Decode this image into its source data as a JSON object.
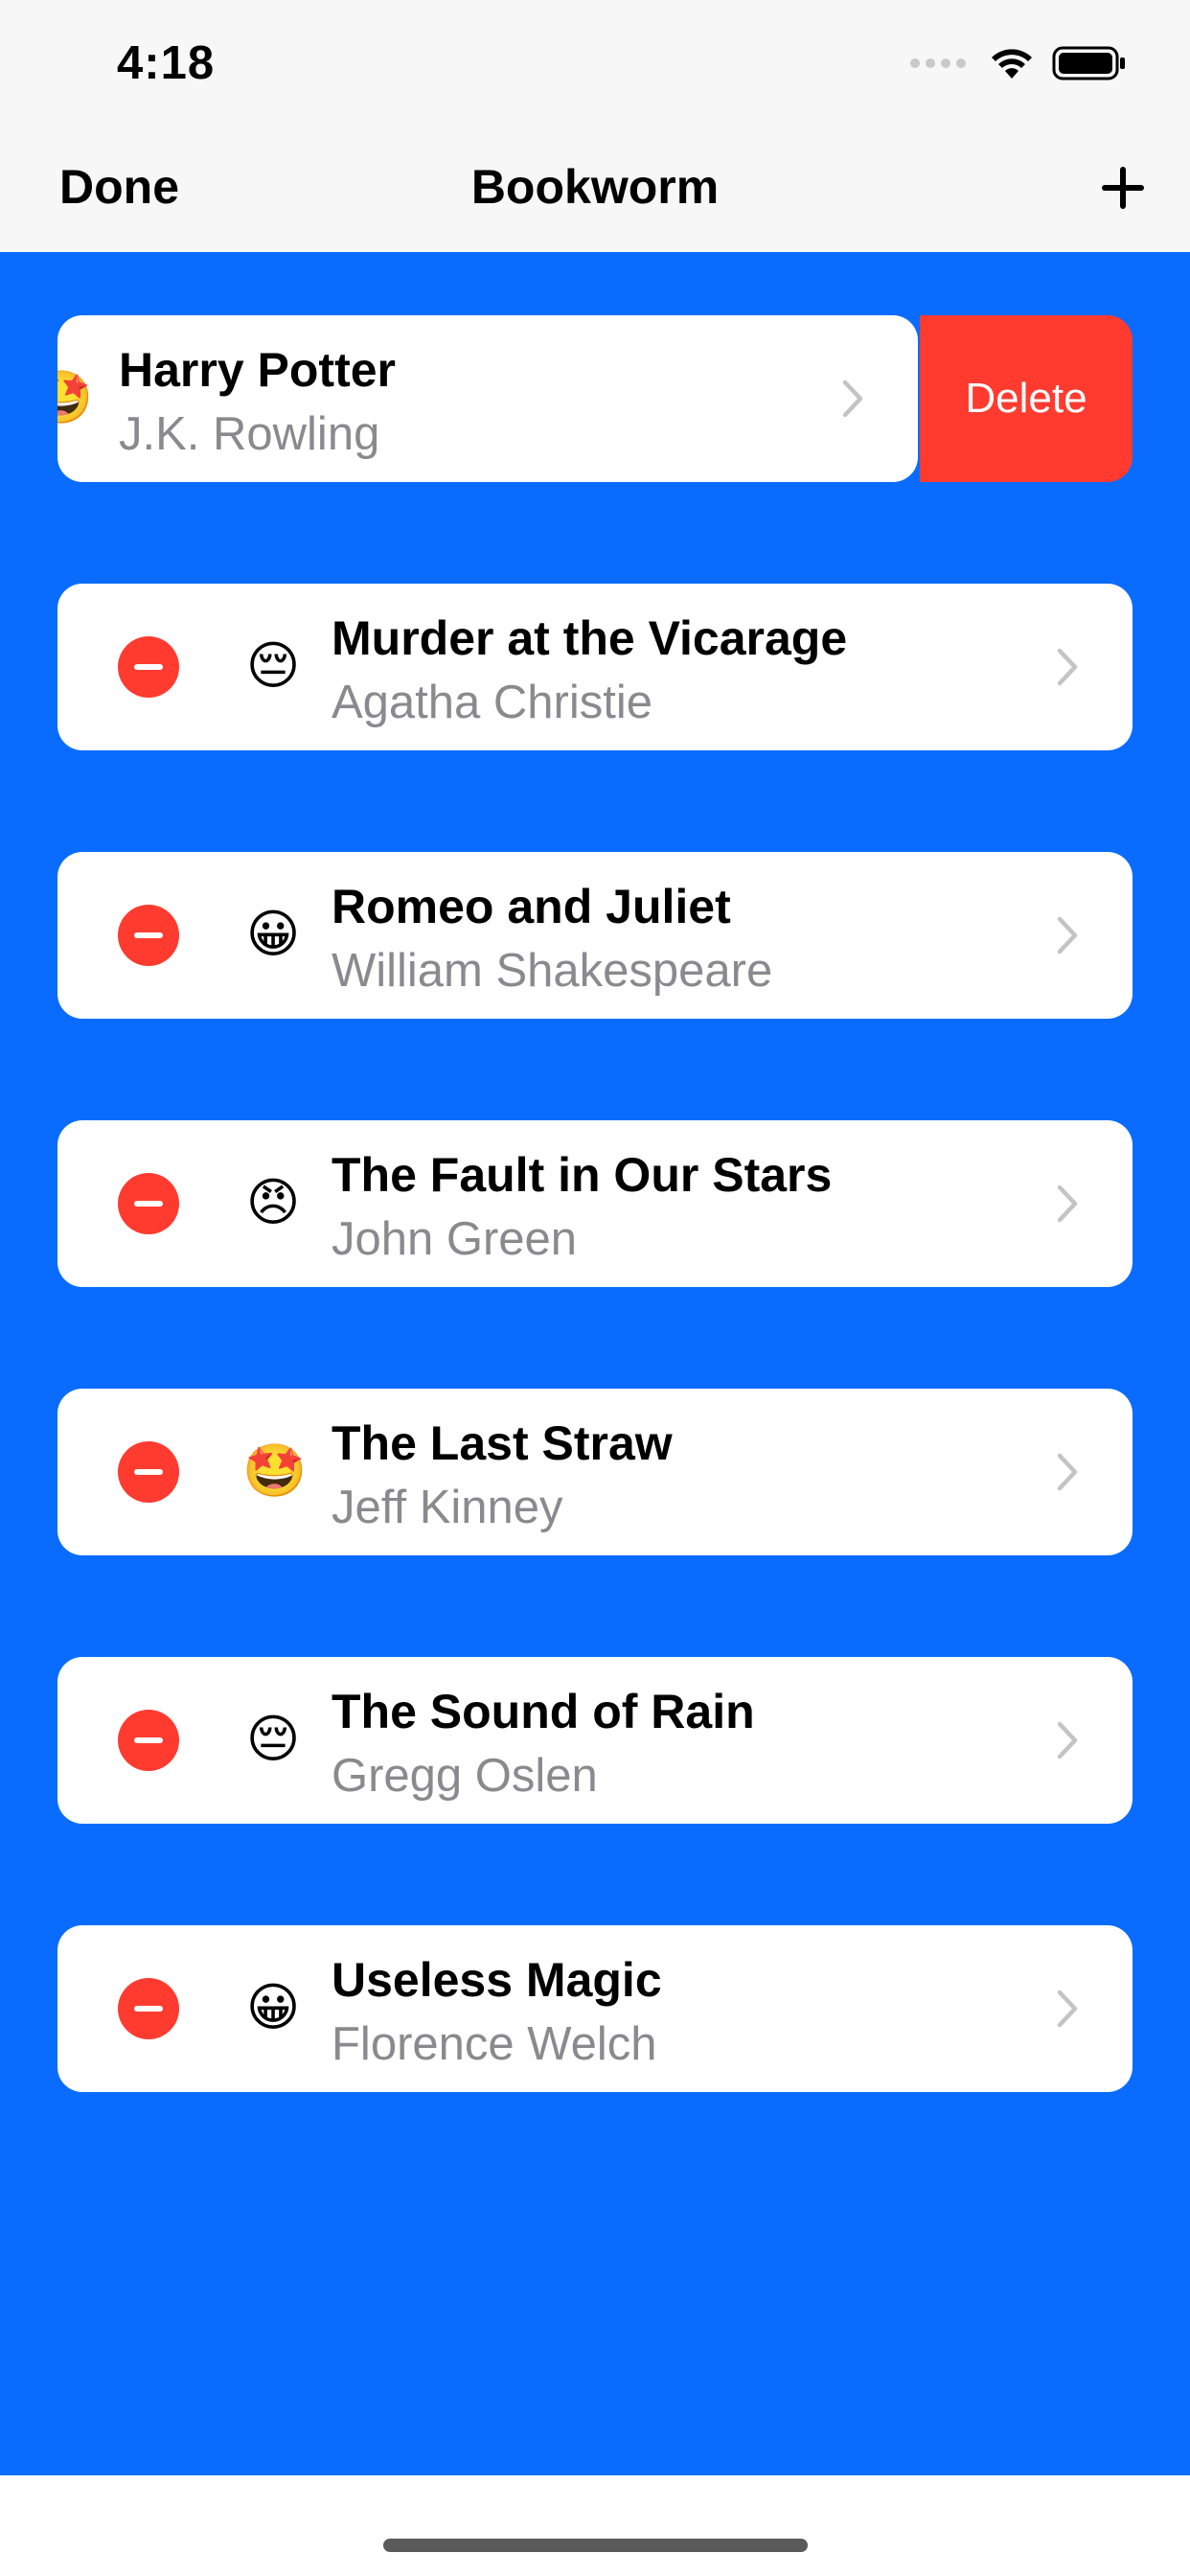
{
  "status_bar": {
    "time": "4:18"
  },
  "nav": {
    "done_label": "Done",
    "title": "Bookworm",
    "add_label": "+"
  },
  "swiped_row": {
    "emoji": "🤩",
    "title": "Harry Potter",
    "author": "J.K. Rowling",
    "delete_label": "Delete"
  },
  "books": [
    {
      "emoji": "😔",
      "title": "Murder at the Vicarage",
      "author": "Agatha Christie"
    },
    {
      "emoji": "😀",
      "title": "Romeo and Juliet",
      "author": "William Shakespeare"
    },
    {
      "emoji": "😠",
      "title": "The Fault in Our Stars",
      "author": "John Green"
    },
    {
      "emoji": "🤩",
      "title": "The Last Straw",
      "author": "Jeff Kinney"
    },
    {
      "emoji": "😔",
      "title": "The Sound of Rain",
      "author": "Gregg Oslen"
    },
    {
      "emoji": "😀",
      "title": "Useless Magic",
      "author": "Florence Welch"
    }
  ],
  "colors": {
    "list_background": "#0a6cff",
    "delete_red": "#ff3b30",
    "secondary_text": "#8a8a8e"
  }
}
